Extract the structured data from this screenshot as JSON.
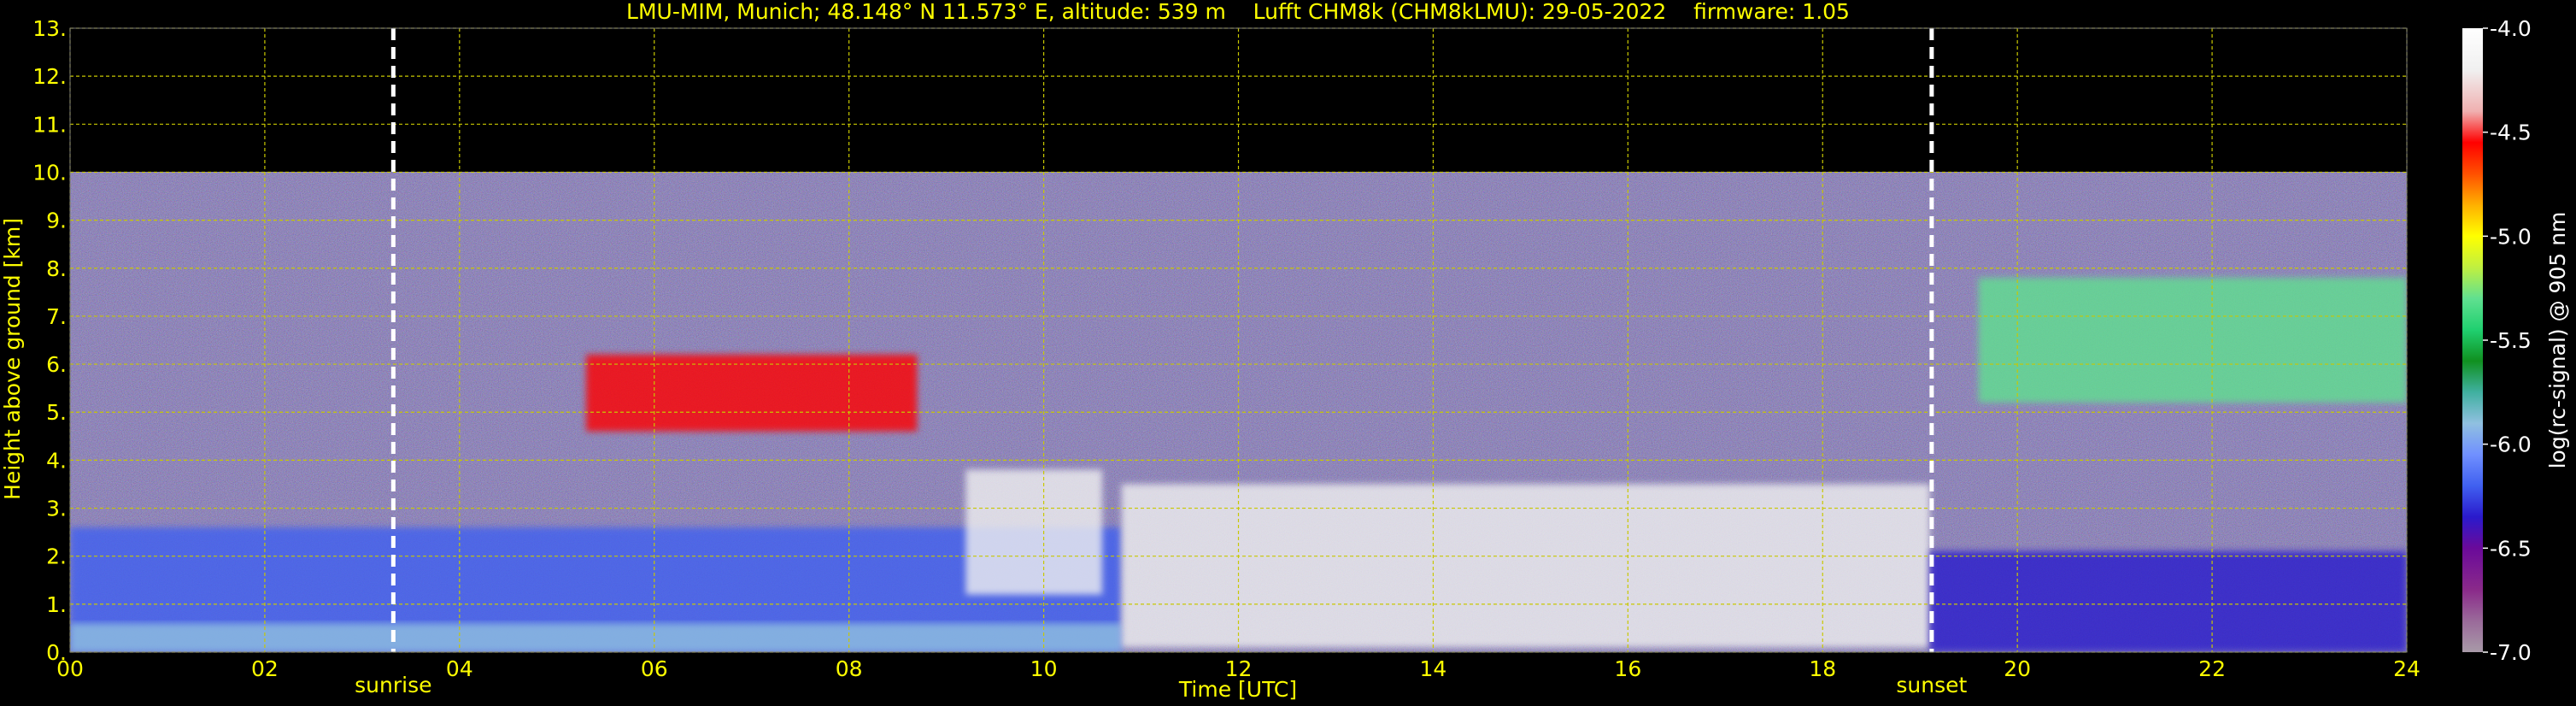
{
  "colors": {
    "background": "#000000",
    "text": "#ffff00",
    "grid": "#c8c800",
    "marker": "#ffffff",
    "colorbar_text": "#ffffff"
  },
  "chart_data": {
    "type": "heatmap",
    "title": "LMU-MIM, Munich; 48.148° N 11.573° E, altitude: 539 m    Lufft CHM8k (CHM8kLMU): 29-05-2022    firmware: 1.05",
    "xlabel": "Time [UTC]",
    "ylabel": "Height above ground [km]",
    "xlim": [
      0,
      24
    ],
    "ylim": [
      0,
      13
    ],
    "x_ticks": [
      "00",
      "02",
      "04",
      "06",
      "08",
      "10",
      "12",
      "14",
      "16",
      "18",
      "20",
      "22",
      "24"
    ],
    "y_ticks": [
      "0.",
      "1.",
      "2.",
      "3.",
      "4.",
      "5.",
      "6.",
      "7.",
      "8.",
      "9.",
      "10.",
      "11.",
      "12.",
      "13."
    ],
    "grid": true,
    "valid_data_top_km": 10,
    "events": [
      {
        "label": "sunrise",
        "time_h": 3.32
      },
      {
        "label": "sunset",
        "time_h": 19.12
      }
    ],
    "colorbar": {
      "label": "log(rc-signal) @ 905 nm",
      "ticks": [
        "-4.0",
        "-4.5",
        "-5.0",
        "-5.5",
        "-6.0",
        "-6.5",
        "-7.0"
      ],
      "range": [
        -7.0,
        -4.0
      ]
    },
    "features": [
      {
        "name": "residual-layer",
        "t_start": 0,
        "t_end": 10.8,
        "z_bottom": 0,
        "z_top": 2.6,
        "log_signal": -6.3
      },
      {
        "name": "near-surface-aerosol",
        "t_start": 0,
        "t_end": 10.8,
        "z_bottom": 0,
        "z_top": 0.6,
        "log_signal": -6.0
      },
      {
        "name": "cirrus-morning",
        "t_start": 5.3,
        "t_end": 8.7,
        "z_bottom": 4.6,
        "z_top": 6.2,
        "log_signal": -4.6
      },
      {
        "name": "cloud-descending",
        "t_start": 9.2,
        "t_end": 10.6,
        "z_bottom": 1.2,
        "z_top": 3.8,
        "log_signal": -4.3
      },
      {
        "name": "boundary-layer-clouds",
        "t_start": 10.8,
        "t_end": 19.1,
        "z_bottom": 0.1,
        "z_top": 3.5,
        "log_signal": -4.2
      },
      {
        "name": "evening-residual-layer",
        "t_start": 19.1,
        "t_end": 24,
        "z_bottom": 0,
        "z_top": 2.1,
        "log_signal": -6.4
      },
      {
        "name": "cirrus-evening",
        "t_start": 19.6,
        "t_end": 24,
        "z_bottom": 5.2,
        "z_top": 7.8,
        "log_signal": -5.4
      }
    ]
  }
}
